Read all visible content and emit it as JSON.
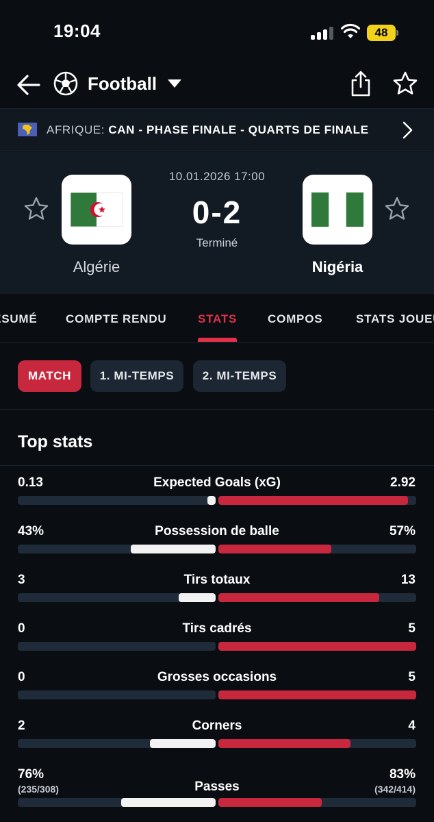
{
  "status_bar": {
    "time": "19:04",
    "battery": "48"
  },
  "header": {
    "sport": "Football"
  },
  "competition": {
    "region": "AFRIQUE:",
    "name": "CAN - PHASE FINALE - QUARTS DE FINALE"
  },
  "match": {
    "date": "10.01.2026 17:00",
    "score": "0-2",
    "status": "Terminé",
    "home": {
      "name": "Algérie"
    },
    "away": {
      "name": "Nigéria"
    }
  },
  "tabs": [
    {
      "label": "RÉSUMÉ"
    },
    {
      "label": "COMPTE RENDU"
    },
    {
      "label": "STATS"
    },
    {
      "label": "COMPOS"
    },
    {
      "label": "STATS JOUEURS"
    }
  ],
  "periods": [
    {
      "label": "MATCH"
    },
    {
      "label": "1. MI-TEMPS"
    },
    {
      "label": "2. MI-TEMPS"
    }
  ],
  "stats_section": {
    "title": "Top stats"
  },
  "stats": [
    {
      "label": "Expected Goals (xG)",
      "home": "0.13",
      "away": "2.92",
      "home_share": 0.043,
      "away_share": 0.957
    },
    {
      "label": "Possession de balle",
      "home": "43%",
      "away": "57%",
      "home_share": 0.43,
      "away_share": 0.57
    },
    {
      "label": "Tirs totaux",
      "home": "3",
      "away": "13",
      "home_share": 0.1875,
      "away_share": 0.8125
    },
    {
      "label": "Tirs cadrés",
      "home": "0",
      "away": "5",
      "home_share": 0,
      "away_share": 1
    },
    {
      "label": "Grosses occasions",
      "home": "0",
      "away": "5",
      "home_share": 0,
      "away_share": 1
    },
    {
      "label": "Corners",
      "home": "2",
      "away": "4",
      "home_share": 0.333,
      "away_share": 0.667
    },
    {
      "label": "Passes",
      "home": "76%",
      "away": "83%",
      "home_sub": "(235/308)",
      "away_sub": "(342/414)",
      "home_share": 0.478,
      "away_share": 0.522
    }
  ],
  "colors": {
    "accent": "#e0334a",
    "away_bar": "#c8283d",
    "home_bar": "#f2f2f2",
    "track": "#1f2b38"
  }
}
